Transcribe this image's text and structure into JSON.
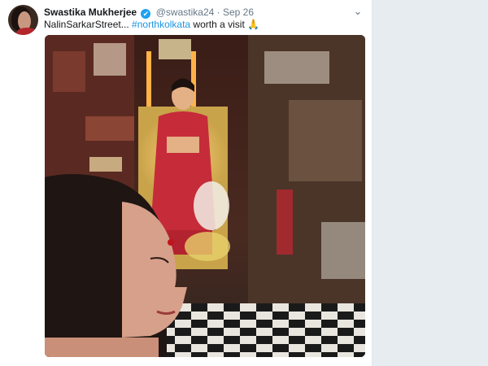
{
  "tweet": {
    "author_name": "Swastika Mukherjee",
    "verified_mark": "✔",
    "handle": "@swastika24",
    "separator": "·",
    "date": "Sep 26",
    "text_before": "NalinSarkarStreet... ",
    "hashtag": "#northkolkata",
    "text_after": " worth a visit ",
    "emoji": "🙏",
    "menu_icon": "chevron-down-icon",
    "menu_glyph": "⌄"
  },
  "photo": {
    "icon": "pandal-selfie-photo"
  },
  "colors": {
    "link": "#1b95e0",
    "verified": "#1da1f2",
    "text": "#14171a",
    "muted": "#657786"
  }
}
